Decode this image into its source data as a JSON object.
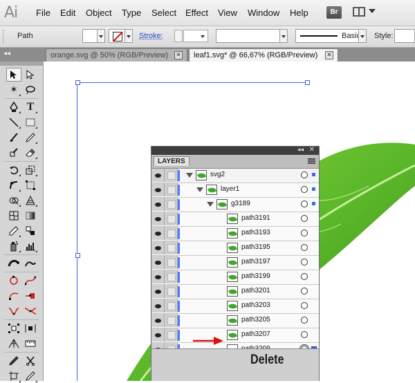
{
  "app": {
    "logo": "Ai"
  },
  "menu": [
    "File",
    "Edit",
    "Object",
    "Type",
    "Select",
    "Effect",
    "View",
    "Window",
    "Help"
  ],
  "menubar_right": {
    "bridge_label": "Br"
  },
  "control_bar": {
    "selection_type": "Path",
    "stroke_label": "Stroke:",
    "brush_label": "Basic",
    "style_label": "Style:"
  },
  "tabs": [
    {
      "label": "orange.svg @ 50% (RGB/Preview)",
      "active": false
    },
    {
      "label": "leaf1.svg* @ 66,67% (RGB/Preview)",
      "active": true
    }
  ],
  "tab_close_glyph": "✕",
  "layers_panel": {
    "title": "LAYERS",
    "rows": [
      {
        "name": "svg2",
        "level": 0,
        "expanded": true,
        "has_thumb": true,
        "selected_marker": true
      },
      {
        "name": "layer1",
        "level": 1,
        "expanded": true,
        "has_thumb": true,
        "selected_marker": true
      },
      {
        "name": "g3189",
        "level": 2,
        "expanded": true,
        "has_thumb": true,
        "selected_marker": true
      },
      {
        "name": "path3191",
        "level": 3,
        "has_thumb": true,
        "selected_marker": false
      },
      {
        "name": "path3193",
        "level": 3,
        "has_thumb": true,
        "selected_marker": false
      },
      {
        "name": "path3195",
        "level": 3,
        "has_thumb": true,
        "selected_marker": false
      },
      {
        "name": "path3197",
        "level": 3,
        "has_thumb": true,
        "selected_marker": false
      },
      {
        "name": "path3199",
        "level": 3,
        "has_thumb": true,
        "selected_marker": false
      },
      {
        "name": "path3201",
        "level": 3,
        "has_thumb": true,
        "selected_marker": false
      },
      {
        "name": "path3203",
        "level": 3,
        "has_thumb": true,
        "selected_marker": false
      },
      {
        "name": "path3205",
        "level": 3,
        "has_thumb": true,
        "selected_marker": false
      },
      {
        "name": "path3207",
        "level": 3,
        "has_thumb": true,
        "selected_marker": false
      },
      {
        "name": "path3209",
        "level": 3,
        "has_thumb": false,
        "selected_marker": true
      }
    ]
  },
  "annotation": {
    "label": "Delete"
  },
  "colors": {
    "selection_blue": "#3f5fe0",
    "leaf_green": "#5cb82a",
    "arrow_red": "#e01010"
  },
  "tools": [
    "selection-tool",
    "direct-selection-tool",
    "magic-wand-tool",
    "lasso-tool",
    "pen-tool",
    "type-tool",
    "line-tool",
    "rectangle-tool",
    "paintbrush-tool",
    "pencil-tool",
    "blob-brush-tool",
    "eraser-tool",
    "rotate-tool",
    "scale-tool",
    "warp-tool",
    "free-transform-tool",
    "shape-builder-tool",
    "perspective-grid-tool",
    "mesh-tool",
    "gradient-tool",
    "eyedropper-tool",
    "blend-tool",
    "symbol-sprayer-tool",
    "column-graph-tool",
    "artboard-tool",
    "slice-tool",
    "hand-tool",
    "zoom-tool"
  ]
}
